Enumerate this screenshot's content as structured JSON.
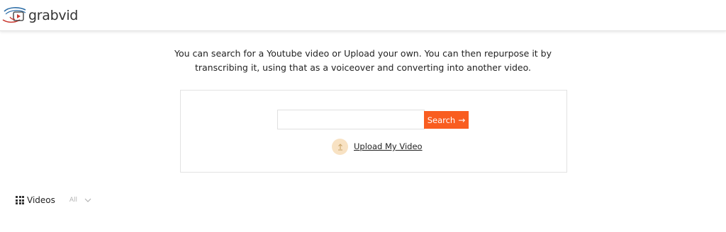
{
  "header": {
    "logo_text": "grabvid"
  },
  "intro": {
    "line1": "You can search for a Youtube video or Upload your own. You can then repurpose it by",
    "line2": "transcribing it, using that as a voiceover and converting into another video."
  },
  "search": {
    "value": "",
    "placeholder": "",
    "button_label": "Search",
    "button_icon": "arrow-right-icon"
  },
  "upload": {
    "label": "Upload My Video",
    "icon": "upload-icon"
  },
  "videos": {
    "label": "Videos",
    "icon": "grid-icon",
    "filter_value": "All",
    "filter_icon": "chevron-down-icon"
  },
  "colors": {
    "accent": "#f95d20",
    "upload_circle": "#f8e2c3",
    "logo_red": "#c9382f",
    "logo_blue": "#2f6fa8"
  }
}
